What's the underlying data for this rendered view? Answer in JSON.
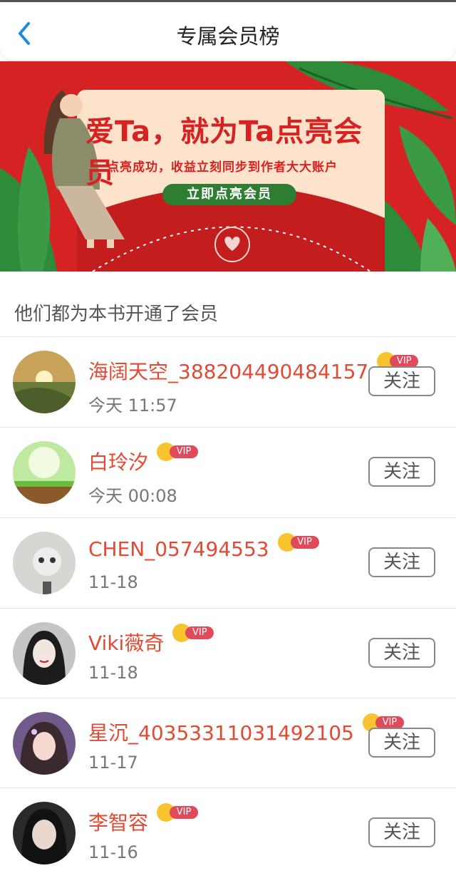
{
  "header": {
    "title": "专属会员榜",
    "back_icon": "chevron-left-icon"
  },
  "banner": {
    "title": "爱Ta，就为Ta点亮会员",
    "subtitle": "点亮成功，收益立刻同步到作者大大账户",
    "button": "立即点亮会员",
    "colors": {
      "background": "#d52323",
      "card": "#fde3cc",
      "button": "#2e7d32"
    }
  },
  "section": {
    "label": "他们都为本书开通了会员"
  },
  "members": [
    {
      "name": "海阔天空_388204490484157",
      "time": "今天 11:57",
      "badge": "VIP",
      "follow": "关注"
    },
    {
      "name": "白玲汐",
      "time": "今天 00:08",
      "badge": "VIP",
      "follow": "关注"
    },
    {
      "name": "CHEN_057494553",
      "time": "11-18",
      "badge": "VIP",
      "follow": "关注"
    },
    {
      "name": "Viki薇奇",
      "time": "11-18",
      "badge": "VIP",
      "follow": "关注"
    },
    {
      "name": "星沉_40353311031492105",
      "time": "11-17",
      "badge": "VIP",
      "follow": "关注"
    },
    {
      "name": "李智容",
      "time": "11-16",
      "badge": "VIP",
      "follow": "关注"
    }
  ],
  "colors": {
    "accent": "#1a8ce0",
    "name": "#e14a33",
    "vip": "#e14a5a",
    "crown": "#f7c430"
  }
}
